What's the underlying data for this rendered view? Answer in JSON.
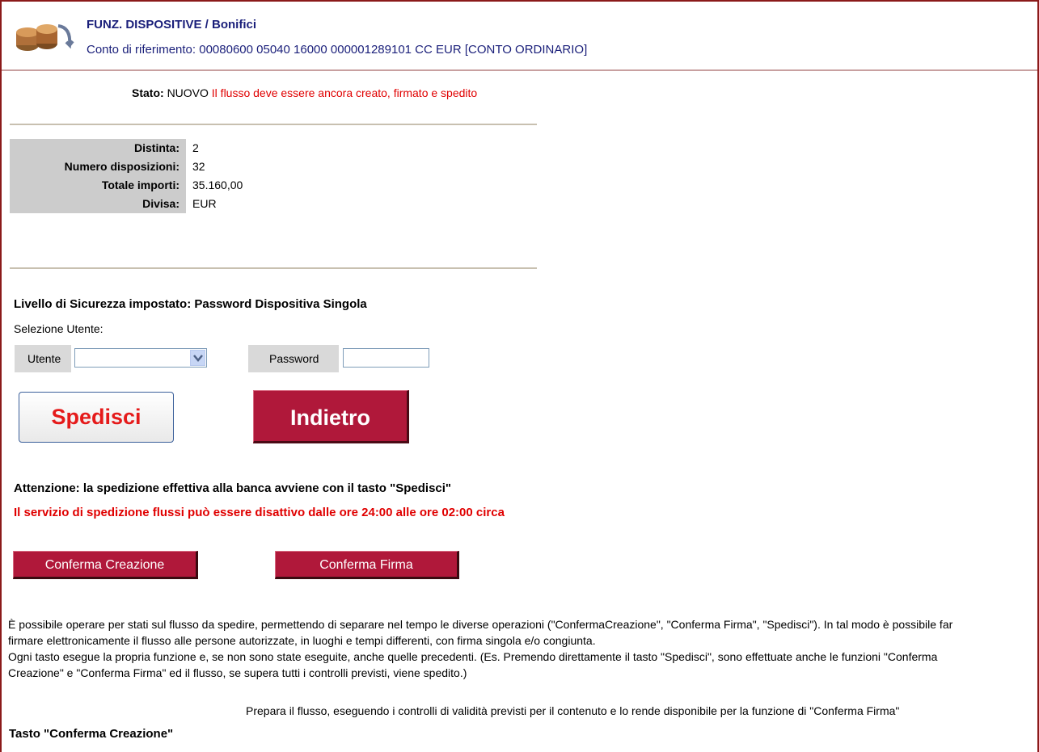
{
  "header": {
    "title": "FUNZ. DISPOSITIVE / Bonifici",
    "account_label": "Conto di riferimento: 00080600 05040 16000 000001289101 CC EUR [CONTO ORDINARIO]",
    "logo_icon": "coins-icon"
  },
  "status": {
    "label": "Stato:",
    "value": "NUOVO",
    "message": "Il flusso deve essere ancora creato, firmato e spedito",
    "message_color": "#e00000"
  },
  "summary": [
    {
      "label": "Distinta:",
      "value": "2"
    },
    {
      "label": "Numero disposizioni:",
      "value": "32"
    },
    {
      "label": "Totale importi:",
      "value": "35.160,00"
    },
    {
      "label": "Divisa:",
      "value": "EUR"
    }
  ],
  "security": {
    "title": "Livello di Sicurezza impostato: Password Dispositiva Singola",
    "select_user_label": "Selezione Utente:",
    "user_label": "Utente",
    "user_value": "",
    "password_label": "Password",
    "password_value": ""
  },
  "buttons": {
    "spedisci": "Spedisci",
    "indietro": "Indietro",
    "conferma_creazione": "Conferma Creazione",
    "conferma_firma": "Conferma Firma"
  },
  "warnings": {
    "line1": "Attenzione: la spedizione effettiva alla banca avviene con il tasto \"Spedisci\"",
    "line2": "Il servizio di spedizione flussi può essere disattivo dalle ore 24:00 alle ore 02:00 circa"
  },
  "info": {
    "para1": "È possibile operare per stati sul flusso da spedire, permettendo di separare nel tempo le diverse operazioni (\"ConfermaCreazione\", \"Conferma Firma\", \"Spedisci\"). In tal modo è possibile far firmare elettronicamente il flusso alle persone autorizzate, in luoghi e tempi differenti, con firma singola e/o congiunta.",
    "para2": "Ogni tasto esegue la propria funzione e, se non sono state eseguite, anche quelle precedenti. (Es. Premendo direttamente il tasto \"Spedisci\", sono effettuate anche le funzioni \"Conferma Creazione\" e \"Conferma Firma\" ed il flusso, se supera tutti i controlli previsti, viene spedito.)",
    "tasto_label": "Tasto \"Conferma Creazione\"",
    "tasto_desc": "Prepara il flusso, eseguendo i controlli di validità previsti per il contenuto e lo rende disponibile per la funzione di \"Conferma Firma\""
  },
  "colors": {
    "accent": "#b0183a",
    "title_blue": "#1a1f7a",
    "label_grey": "#cccccc"
  }
}
